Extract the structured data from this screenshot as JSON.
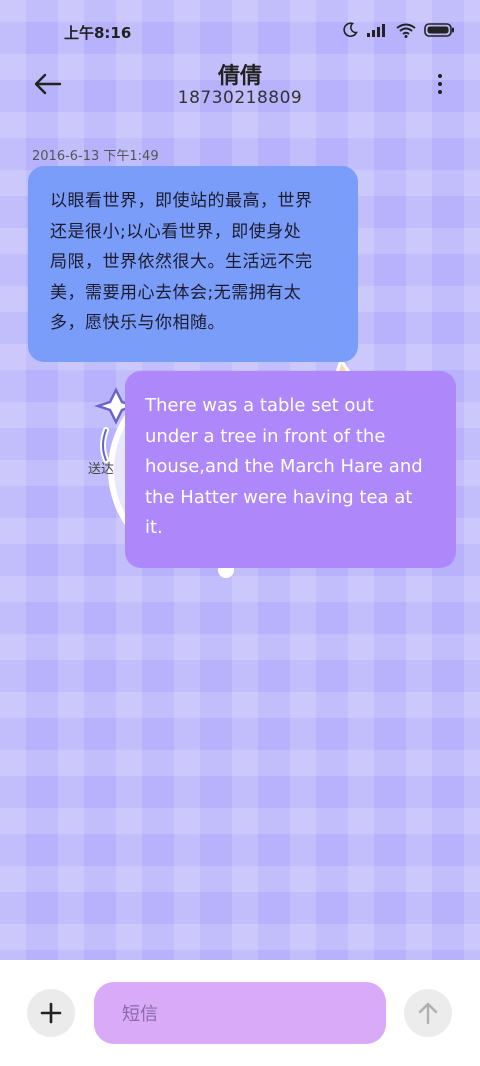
{
  "status_bar": {
    "time": "上午8:16",
    "icons": [
      "moon-icon",
      "signal-icon",
      "wifi-icon",
      "battery-icon"
    ]
  },
  "header": {
    "contact_name": "倩倩",
    "phone": "18730218809",
    "icons": [
      "back-arrow-icon",
      "more-vert-icon"
    ]
  },
  "conversation": {
    "timestamp": "2016-6-13 下午1:49",
    "messages": [
      {
        "direction": "incoming",
        "lines": [
          "以眼看世界，即使站的最高，世界",
          "还是很小;以心看世界，即使身处",
          "局限，世界依然很大。生活远不完",
          "美，需要用心去体会;无需拥有太",
          "多，愿快乐与你相随。"
        ],
        "color": "#7a9df9"
      },
      {
        "direction": "outgoing",
        "lines": [
          "There was a table set out",
          "under a tree in front of the",
          "house,and the March Hare and",
          "the Hatter were having tea at",
          "it."
        ],
        "color": "#ae88fa"
      }
    ],
    "sticker": {
      "caption": "送达"
    }
  },
  "input_bar": {
    "placeholder": "短信",
    "icons": [
      "plus-icon",
      "send-arrow-up-icon"
    ]
  },
  "colors": {
    "background": "#b7b2fb",
    "incoming_bubble": "#7a9df9",
    "outgoing_bubble": "#ae88fa",
    "input_field": "#d8aaf8"
  }
}
